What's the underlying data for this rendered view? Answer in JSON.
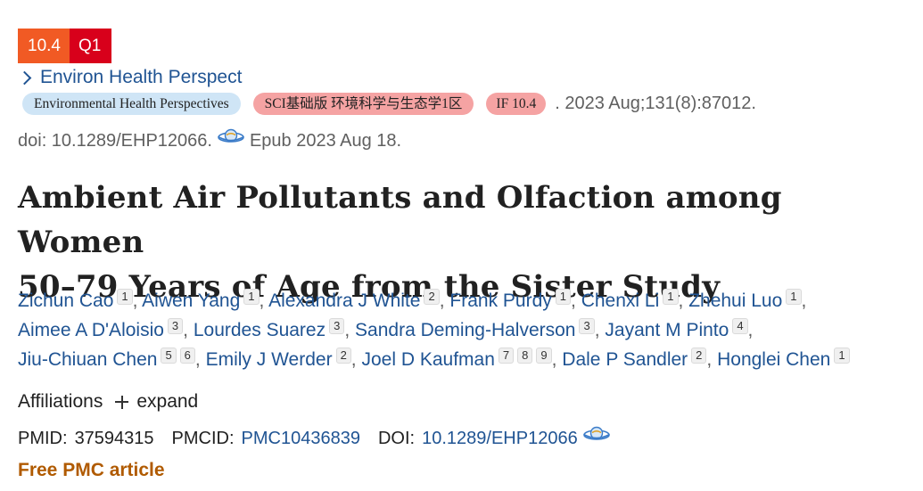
{
  "metrics": {
    "impact_factor": "10.4",
    "quartile": "Q1"
  },
  "journal": {
    "link_text": "Environ Health Perspect"
  },
  "citation": {
    "journal_full": "Environmental Health Perspectives",
    "sci_tag": "SCI基础版 环境科学与生态学1区",
    "if_tag": "IF 10.4",
    "date_volume": ". 2023 Aug;131(8):87012.",
    "doi_text": "doi: 10.1289/EHP12066.",
    "epub": "Epub 2023 Aug 18."
  },
  "title_line1": "Ambient Air Pollutants and Olfaction among Women",
  "title_line2": "50–79 Years of Age from the Sister Study",
  "authors": [
    {
      "name": "Zichun Cao",
      "affs": [
        "1"
      ],
      "sep": ","
    },
    {
      "name": "Aiwen Yang",
      "affs": [
        "1"
      ],
      "sep": ","
    },
    {
      "name": "Alexandra J White",
      "affs": [
        "2"
      ],
      "sep": ","
    },
    {
      "name": "Frank Purdy",
      "affs": [
        "1"
      ],
      "sep": ","
    },
    {
      "name": "Chenxi Li",
      "affs": [
        "1"
      ],
      "sep": ","
    },
    {
      "name": "Zhehui Luo",
      "affs": [
        "1"
      ],
      "sep": ","
    },
    {
      "name": "Aimee A D'Aloisio",
      "affs": [
        "3"
      ],
      "sep": ","
    },
    {
      "name": "Lourdes Suarez",
      "affs": [
        "3"
      ],
      "sep": ","
    },
    {
      "name": "Sandra Deming-Halverson",
      "affs": [
        "3"
      ],
      "sep": ","
    },
    {
      "name": "Jayant M Pinto",
      "affs": [
        "4"
      ],
      "sep": ","
    },
    {
      "name": "Jiu-Chiuan Chen",
      "affs": [
        "5",
        "6"
      ],
      "sep": ","
    },
    {
      "name": "Emily J Werder",
      "affs": [
        "2"
      ],
      "sep": ","
    },
    {
      "name": "Joel D Kaufman",
      "affs": [
        "7",
        "8",
        "9"
      ],
      "sep": ","
    },
    {
      "name": "Dale P Sandler",
      "affs": [
        "2"
      ],
      "sep": ","
    },
    {
      "name": "Honglei Chen",
      "affs": [
        "1"
      ],
      "sep": ""
    }
  ],
  "affiliations": {
    "label": "Affiliations",
    "expand_label": "expand"
  },
  "identifiers": {
    "pmid_label": "PMID:",
    "pmid": "37594315",
    "pmcid_label": "PMCID:",
    "pmcid": "PMC10436839",
    "doi_label": "DOI:",
    "doi": "10.1289/EHP12066"
  },
  "free_pmc": "Free PMC article",
  "colors": {
    "link": "#205493",
    "if_badge": "#f15a24",
    "q_badge": "#d8001b",
    "free_pmc": "#b05a00"
  },
  "icons": [
    "chevron-right-icon",
    "altmetric-planet-icon",
    "plus-icon"
  ]
}
